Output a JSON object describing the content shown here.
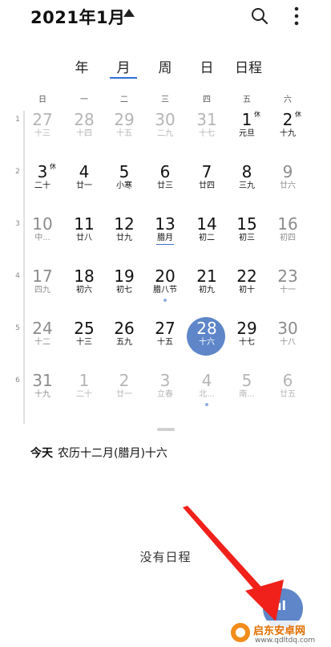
{
  "header": {
    "month_title": "2021年1月",
    "icons": {
      "caret": "caret-up-icon",
      "search": "search-icon",
      "more": "more-vertical-icon"
    }
  },
  "view_tabs": [
    {
      "label": "年",
      "selected": false
    },
    {
      "label": "月",
      "selected": true
    },
    {
      "label": "周",
      "selected": false
    },
    {
      "label": "日",
      "selected": false
    },
    {
      "label": "日程",
      "selected": false
    }
  ],
  "weekdays": [
    "日",
    "一",
    "二",
    "三",
    "四",
    "五",
    "六"
  ],
  "weeks": [
    {
      "num": "1",
      "days": [
        {
          "d": "27",
          "lunar": "十三",
          "other": true
        },
        {
          "d": "28",
          "lunar": "十四",
          "other": true
        },
        {
          "d": "29",
          "lunar": "十五",
          "other": true
        },
        {
          "d": "30",
          "lunar": "二九",
          "other": true
        },
        {
          "d": "31",
          "lunar": "十七",
          "other": true
        },
        {
          "d": "1",
          "lunar": "元旦",
          "mark": "休"
        },
        {
          "d": "2",
          "lunar": "十九",
          "mark": "休"
        }
      ]
    },
    {
      "num": "2",
      "days": [
        {
          "d": "3",
          "lunar": "二十",
          "mark": "休"
        },
        {
          "d": "4",
          "lunar": "廿一"
        },
        {
          "d": "5",
          "lunar": "小寒"
        },
        {
          "d": "6",
          "lunar": "廿三"
        },
        {
          "d": "7",
          "lunar": "廿四"
        },
        {
          "d": "8",
          "lunar": "三九"
        },
        {
          "d": "9",
          "lunar": "廿六",
          "weekend": true
        }
      ]
    },
    {
      "num": "3",
      "days": [
        {
          "d": "10",
          "lunar": "中...",
          "weekend": true
        },
        {
          "d": "11",
          "lunar": "廿八"
        },
        {
          "d": "12",
          "lunar": "廿九"
        },
        {
          "d": "13",
          "lunar": "腊月",
          "underline": true
        },
        {
          "d": "14",
          "lunar": "初二"
        },
        {
          "d": "15",
          "lunar": "初三"
        },
        {
          "d": "16",
          "lunar": "初四",
          "weekend": true
        }
      ]
    },
    {
      "num": "4",
      "days": [
        {
          "d": "17",
          "lunar": "四九",
          "weekend": true
        },
        {
          "d": "18",
          "lunar": "初六"
        },
        {
          "d": "19",
          "lunar": "初七"
        },
        {
          "d": "20",
          "lunar": "腊八节",
          "dot": true
        },
        {
          "d": "21",
          "lunar": "初九"
        },
        {
          "d": "22",
          "lunar": "初十"
        },
        {
          "d": "23",
          "lunar": "十一",
          "weekend": true
        }
      ]
    },
    {
      "num": "5",
      "days": [
        {
          "d": "24",
          "lunar": "十二",
          "weekend": true
        },
        {
          "d": "25",
          "lunar": "十三"
        },
        {
          "d": "26",
          "lunar": "五九"
        },
        {
          "d": "27",
          "lunar": "十五"
        },
        {
          "d": "28",
          "lunar": "十六",
          "today": true
        },
        {
          "d": "29",
          "lunar": "十七"
        },
        {
          "d": "30",
          "lunar": "十八",
          "weekend": true
        }
      ]
    },
    {
      "num": "6",
      "days": [
        {
          "d": "31",
          "lunar": "十九",
          "weekend": true
        },
        {
          "d": "1",
          "lunar": "二十",
          "other": true
        },
        {
          "d": "2",
          "lunar": "廿一",
          "other": true
        },
        {
          "d": "3",
          "lunar": "立春",
          "other": true
        },
        {
          "d": "4",
          "lunar": "北...",
          "other": true,
          "dot": true
        },
        {
          "d": "5",
          "lunar": "南...",
          "other": true
        },
        {
          "d": "6",
          "lunar": "廿五",
          "other": true
        }
      ]
    }
  ],
  "today_info": {
    "label": "今天",
    "lunar_text": "农历十二月(腊月)十六"
  },
  "empty_state": "没有日程",
  "fab": {
    "icon": "add-event-icon",
    "glyph": "ıl"
  },
  "colors": {
    "accent": "#5e86c9",
    "tab_underline": "#2f6fd6",
    "annotation_arrow": "#f0201a"
  },
  "watermark": {
    "title": "启东安卓网",
    "url": "www.qdltdq.com"
  }
}
